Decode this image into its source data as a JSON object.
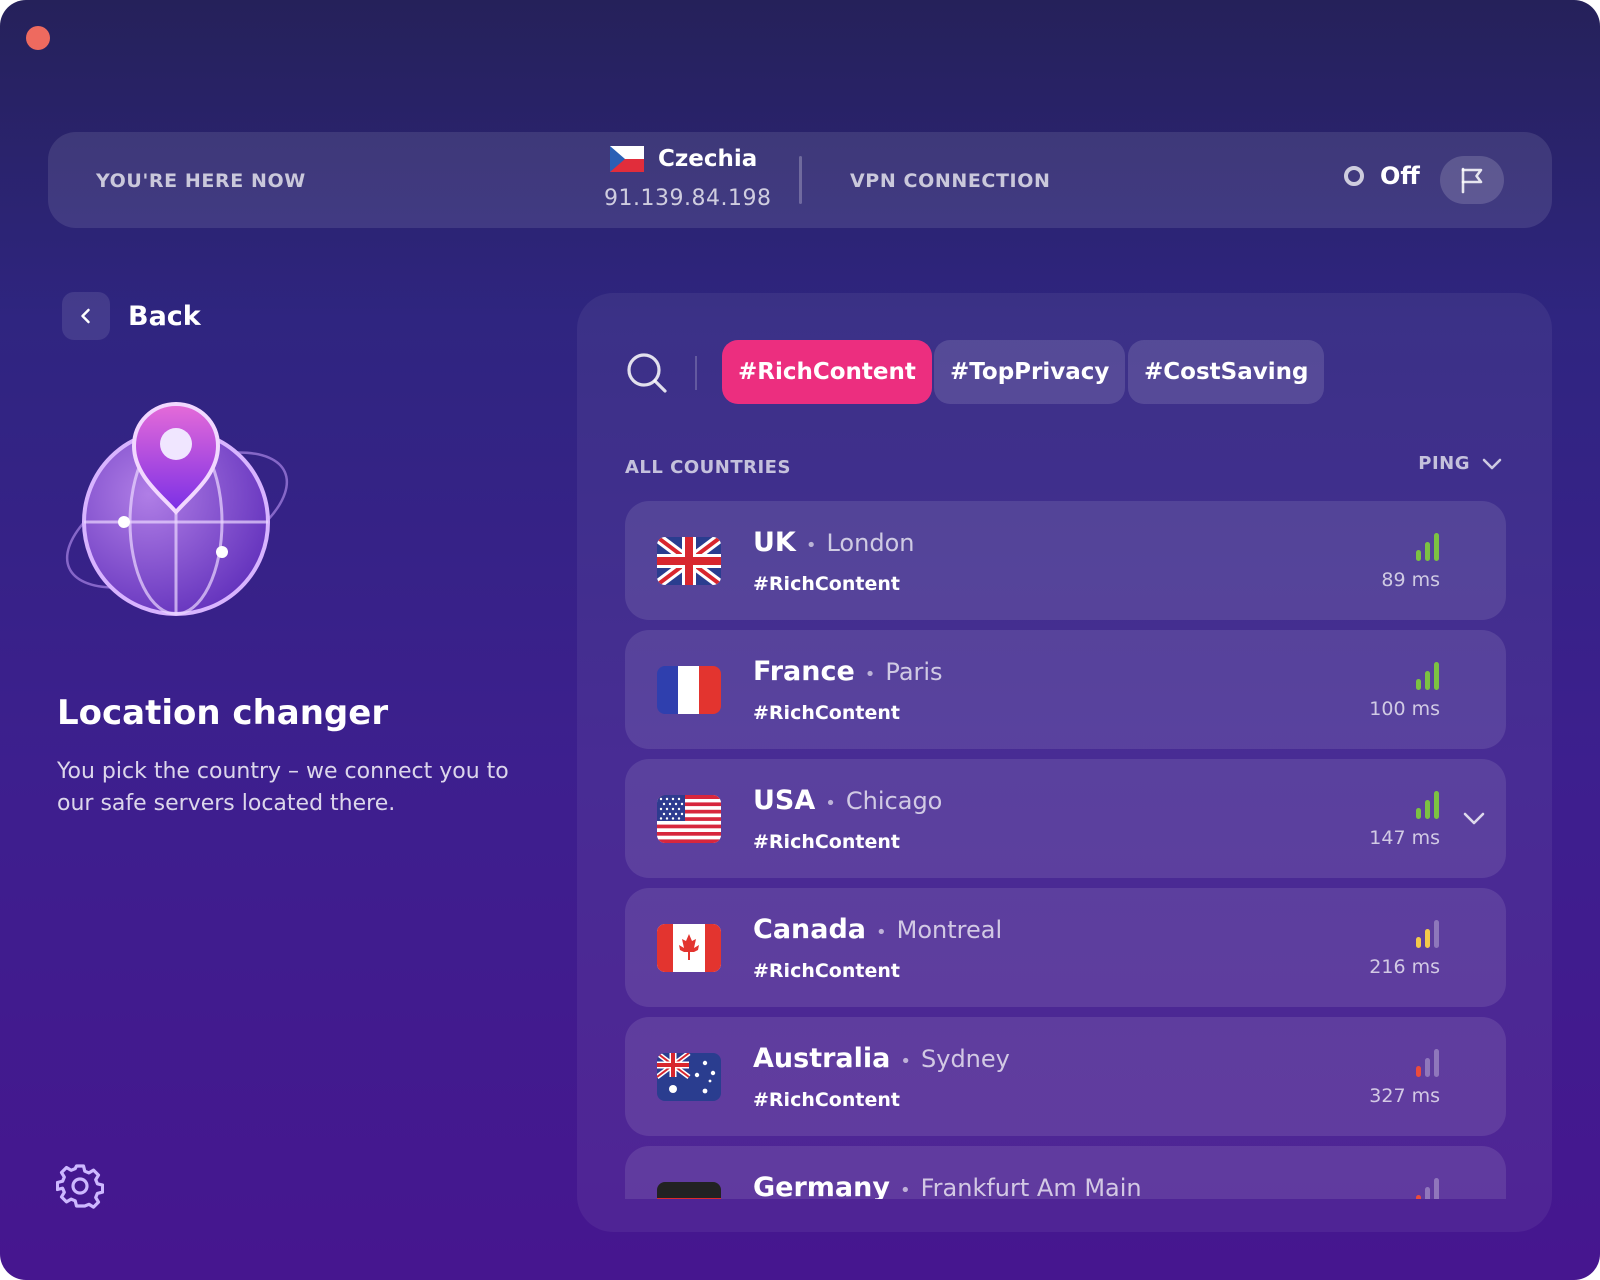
{
  "status_bar": {
    "here_label": "YOU'RE HERE NOW",
    "current_country": "Czechia",
    "current_ip": "91.139.84.198",
    "vpn_label": "VPN CONNECTION",
    "vpn_state": "Off"
  },
  "left": {
    "back_label": "Back",
    "title": "Location changer",
    "description": "You pick the country – we connect you to our safe servers located there."
  },
  "tags": [
    "#RichContent",
    "#TopPrivacy",
    "#CostSaving"
  ],
  "active_tag": "#RichContent",
  "list": {
    "header": "ALL COUNTRIES",
    "sort_label": "PING",
    "rows": [
      {
        "country": "UK",
        "city": "London",
        "tag": "#RichContent",
        "ping": "89 ms",
        "flag": "uk-flag-icon",
        "signal_level": 3,
        "signal_color": "#7cc242"
      },
      {
        "country": "France",
        "city": "Paris",
        "tag": "#RichContent",
        "ping": "100 ms",
        "flag": "france-flag-icon",
        "signal_level": 3,
        "signal_color": "#7cc242"
      },
      {
        "country": "USA",
        "city": "Chicago",
        "tag": "#RichContent",
        "ping": "147 ms",
        "flag": "usa-flag-icon",
        "signal_level": 3,
        "signal_color": "#7cc242"
      },
      {
        "country": "Canada",
        "city": "Montreal",
        "tag": "#RichContent",
        "ping": "216 ms",
        "flag": "canada-flag-icon",
        "signal_level": 2,
        "signal_color": "#f3c94a"
      },
      {
        "country": "Australia",
        "city": "Sydney",
        "tag": "#RichContent",
        "ping": "327 ms",
        "flag": "australia-flag-icon",
        "signal_level": 1,
        "signal_color": "#ec4b3c"
      },
      {
        "country": "Germany",
        "city": "Frankfurt Am Main",
        "tag": "",
        "ping": "",
        "flag": "germany-flag-icon",
        "signal_level": 1,
        "signal_color": "#ec4b3c"
      }
    ]
  },
  "colors": {
    "accent": "#ec2e7f",
    "signal_good": "#7cc242",
    "signal_medium": "#f3c94a",
    "signal_poor": "#ec4b3c",
    "close_button": "#ee6a5f"
  }
}
